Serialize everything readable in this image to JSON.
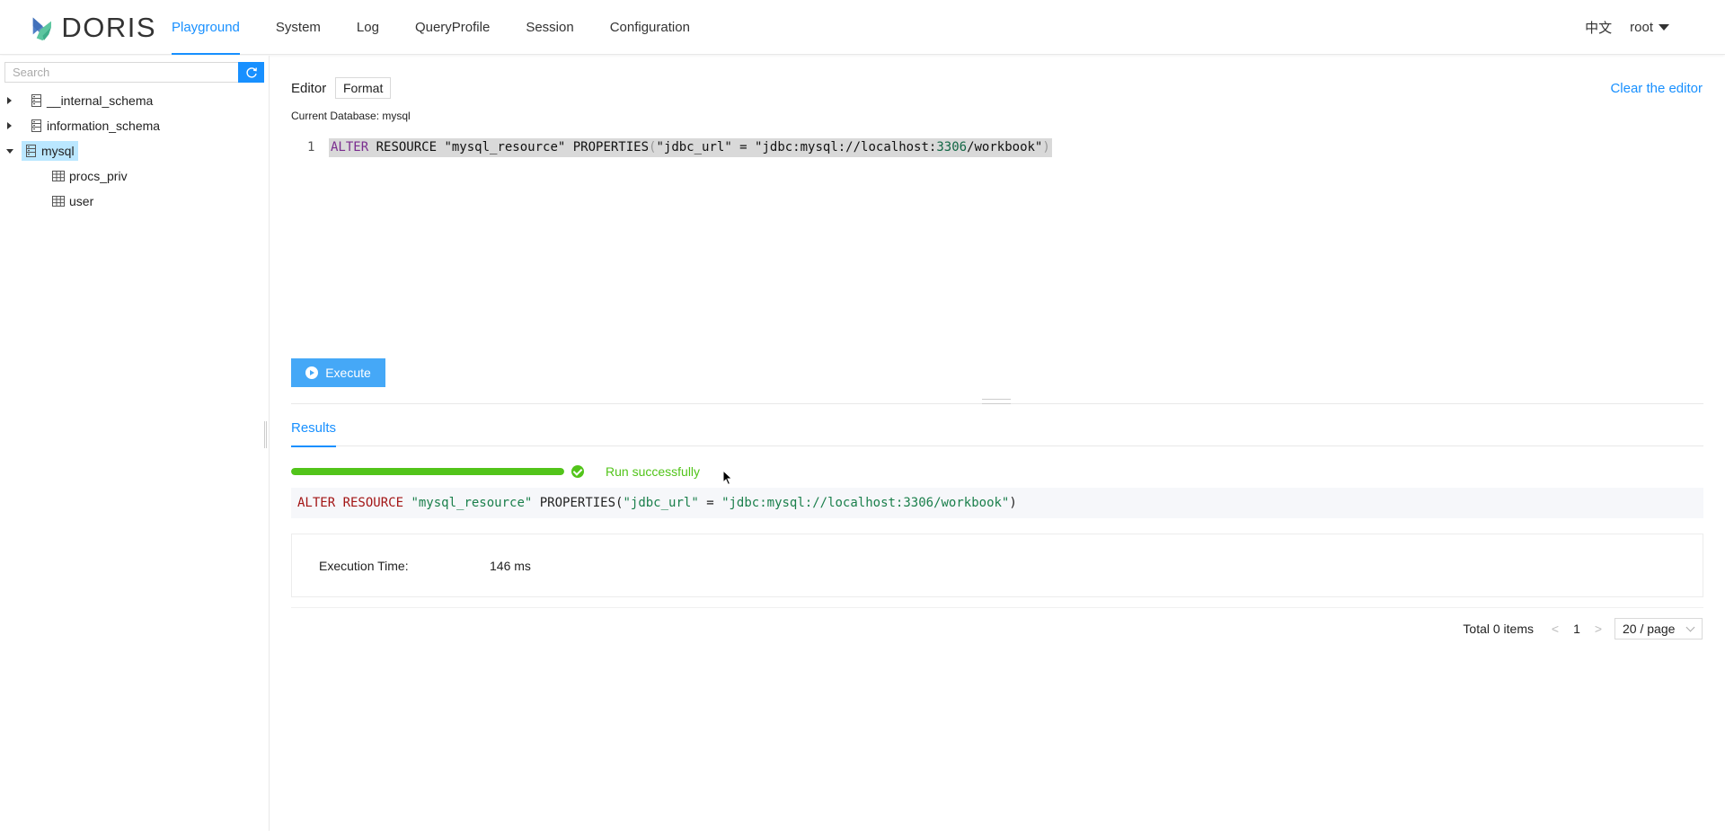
{
  "header": {
    "logo_text": "DORIS",
    "nav": [
      "Playground",
      "System",
      "Log",
      "QueryProfile",
      "Session",
      "Configuration"
    ],
    "active_nav": "Playground",
    "lang": "中文",
    "user": "root"
  },
  "sidebar": {
    "search_placeholder": "Search",
    "tree": [
      {
        "label": "__internal_schema",
        "type": "database",
        "expanded": false
      },
      {
        "label": "information_schema",
        "type": "database",
        "expanded": false
      },
      {
        "label": "mysql",
        "type": "database",
        "expanded": true,
        "selected": true
      },
      {
        "label": "procs_priv",
        "type": "table"
      },
      {
        "label": "user",
        "type": "table"
      }
    ]
  },
  "editor": {
    "label": "Editor",
    "format_label": "Format",
    "clear_label": "Clear the editor",
    "current_db": "Current Database: mysql",
    "line_number": "1",
    "code": {
      "kw": "ALTER",
      "p1": " RESOURCE \"mysql_resource\" PROPERTIES",
      "open": "(",
      "p2": "\"jdbc_url\" = \"jdbc:mysql://localhost:",
      "num": "3306",
      "p3": "/workbook\"",
      "close": ")"
    },
    "execute_label": "Execute"
  },
  "results": {
    "tab_label": "Results",
    "progress_percent": 100,
    "status": "Run successfully",
    "sql": {
      "kw": "ALTER RESOURCE",
      "s1": " \"mysql_resource\"",
      "p1": " PROPERTIES(",
      "s2": "\"jdbc_url\"",
      "p2": " = ",
      "s3": "\"jdbc:mysql://localhost:3306/workbook\"",
      "p3": ")"
    },
    "exec_time_label": "Execution Time:",
    "exec_time_value": "146 ms"
  },
  "pagination": {
    "total": "Total 0 items",
    "prev": "<",
    "page": "1",
    "next": ">",
    "page_size": "20 / page"
  },
  "colors": {
    "primary": "#1890ff",
    "success": "#52c41a",
    "execute_button": "#45a8f7"
  }
}
